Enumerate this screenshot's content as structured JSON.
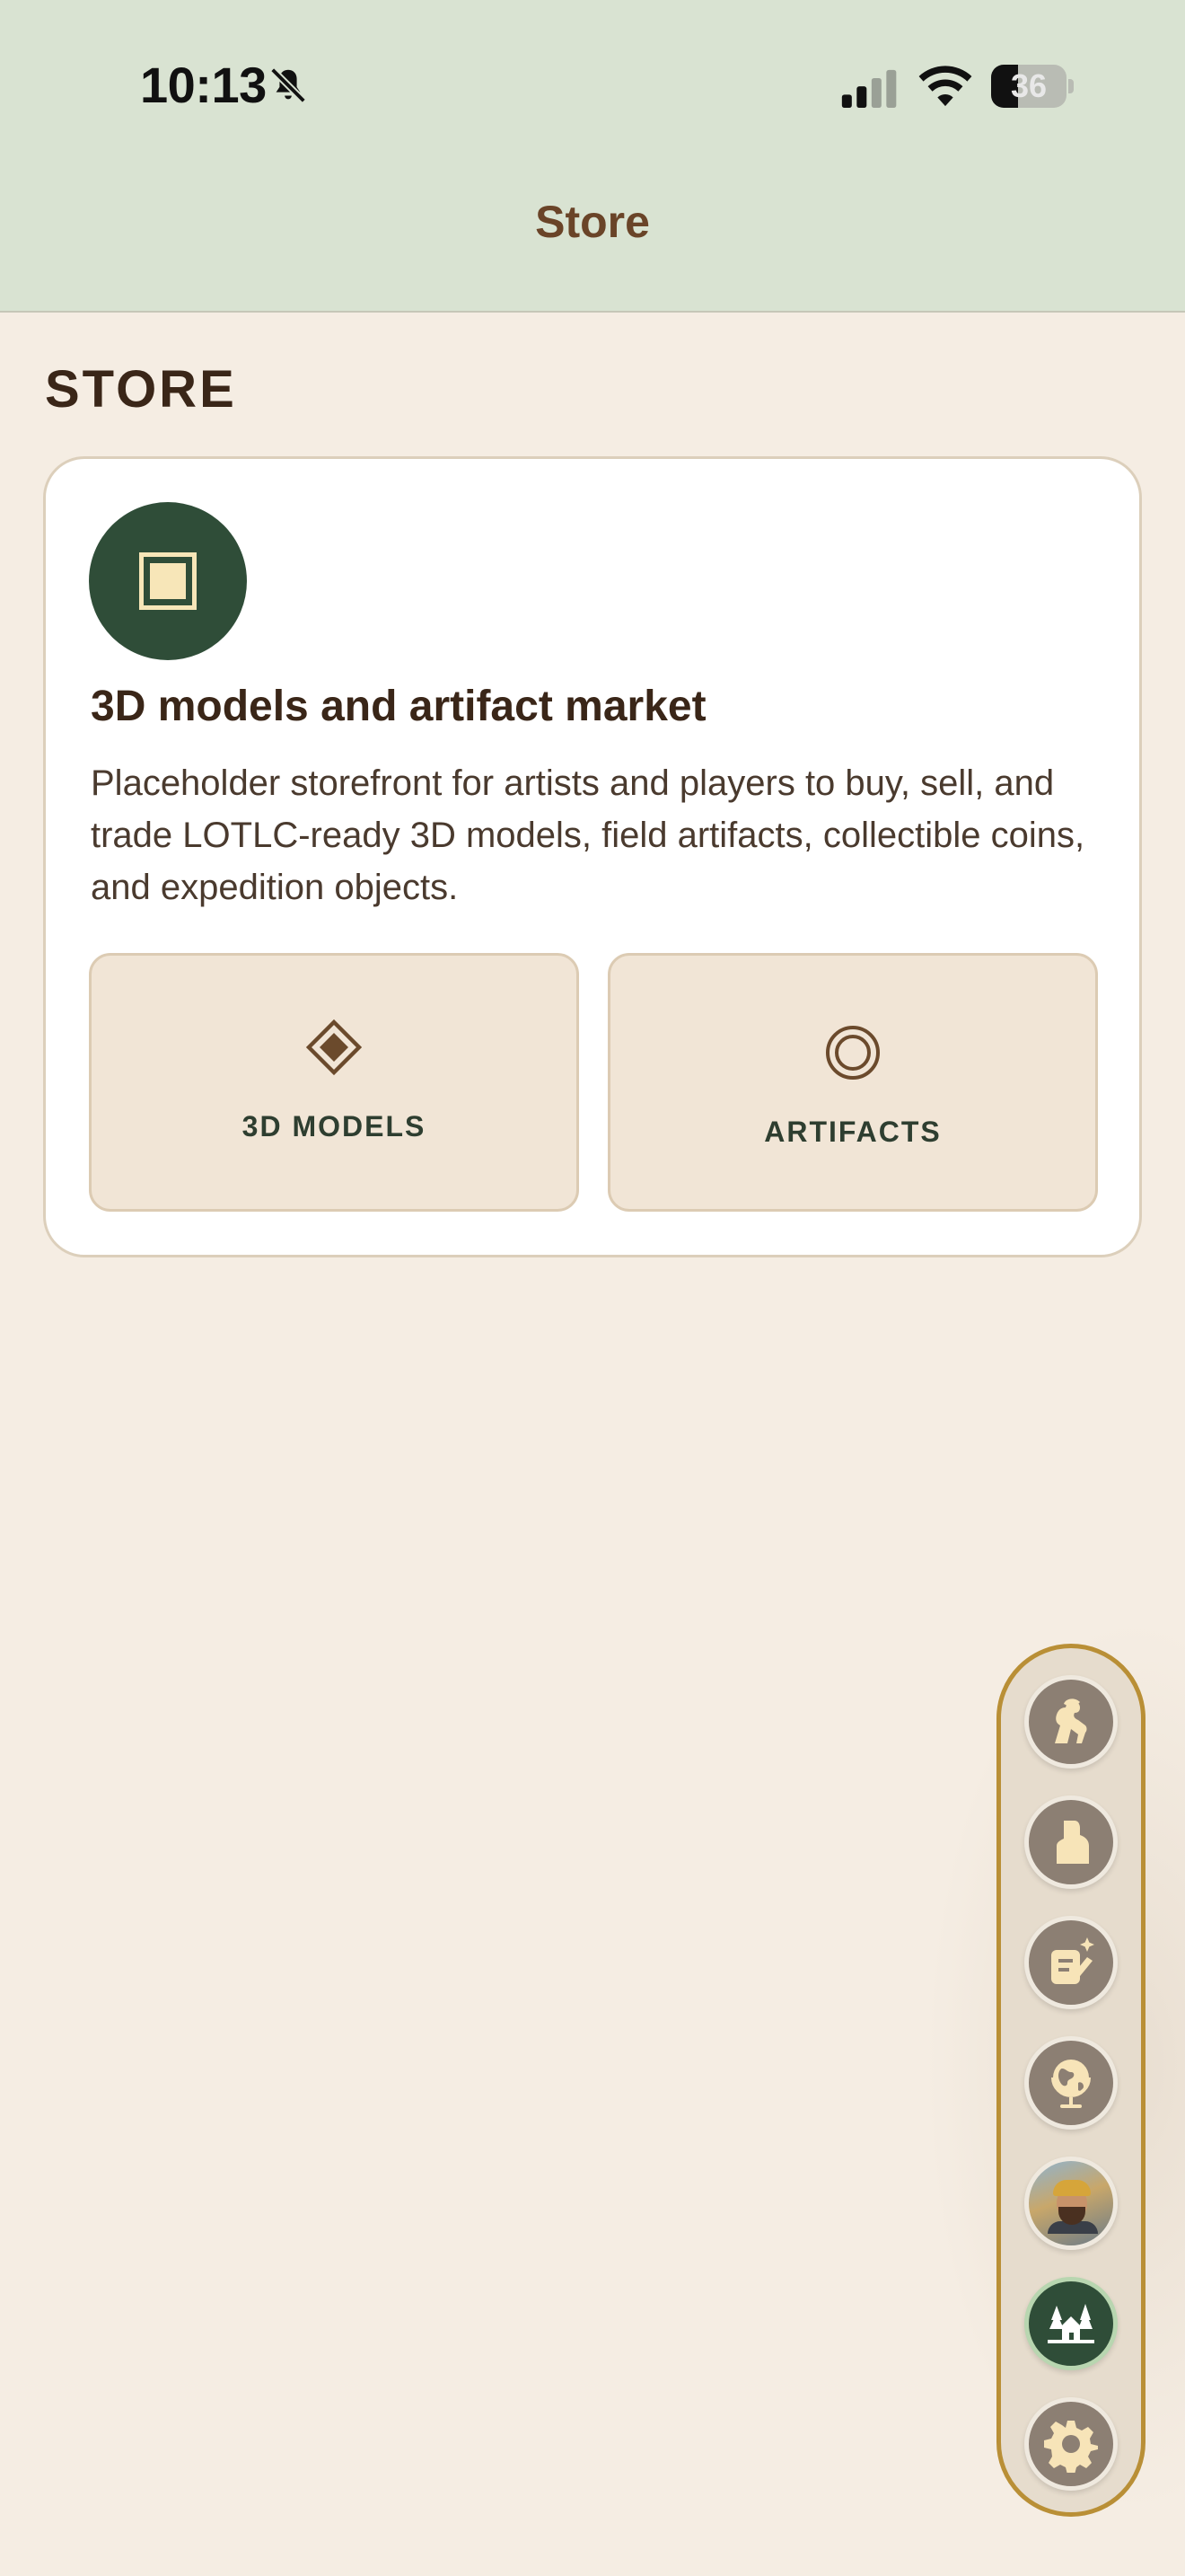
{
  "status_bar": {
    "time": "10:13",
    "battery": "36",
    "battery_level": 0.36
  },
  "nav": {
    "title": "Store"
  },
  "page": {
    "section_title": "STORE"
  },
  "card": {
    "icon": "square-frame-icon",
    "heading": "3D models and artifact market",
    "description": "Placeholder storefront for artists and players to buy, sell, and trade LOTLC-ready 3D models, field artifacts, collectible coins, and expedition objects.",
    "tiles": [
      {
        "label": "3D MODELS",
        "glyph": "◈",
        "icon": "diamond-icon"
      },
      {
        "label": "ARTIFACTS",
        "glyph": "◎",
        "icon": "ring-icon"
      }
    ]
  },
  "side_nav": {
    "items": [
      {
        "icon": "hiker-icon"
      },
      {
        "icon": "profile-icon"
      },
      {
        "icon": "notes-sparkle-icon"
      },
      {
        "icon": "globe-icon"
      },
      {
        "icon": "user-avatar"
      },
      {
        "icon": "cabin-forest-icon",
        "active": true
      },
      {
        "icon": "gear-icon"
      }
    ]
  },
  "colors": {
    "header_bg": "#d9e3d2",
    "page_bg": "#f5ede3",
    "accent_green": "#2f4d38",
    "pill_border": "#b98f36",
    "title_brown": "#6a4428"
  }
}
